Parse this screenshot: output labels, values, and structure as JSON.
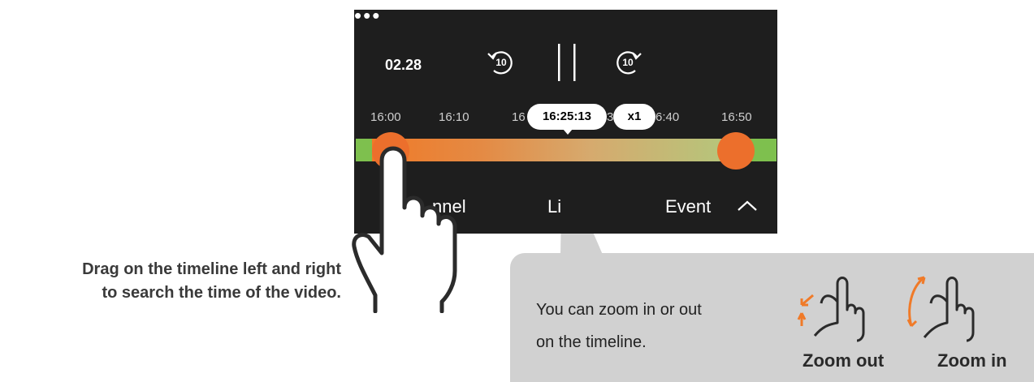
{
  "player": {
    "date": "02.28",
    "rewind_label": "10",
    "forward_label": "10",
    "more_label": "•••"
  },
  "timeline": {
    "ticks": [
      "16:00",
      "16:10",
      "16",
      "30",
      "6:40",
      "16:50"
    ],
    "current_time": "16:25:13",
    "speed": "x1"
  },
  "bottom_bar": {
    "channel_label": "nnel",
    "live_label": "Li",
    "event_label": "Event"
  },
  "instructions": {
    "drag_line1": "Drag on the timeline left and right",
    "drag_line2": "to search the time of the video.",
    "zoom_text_line1": "You can zoom in or out",
    "zoom_text_line2": "on the timeline.",
    "zoom_out_label": "Zoom out",
    "zoom_in_label": "Zoom in"
  },
  "colors": {
    "panel_bg": "#1e1e1e",
    "track_green": "#7ec04e",
    "accent_orange": "#ec6f2c",
    "bubble_gray": "#d1d1d1"
  }
}
